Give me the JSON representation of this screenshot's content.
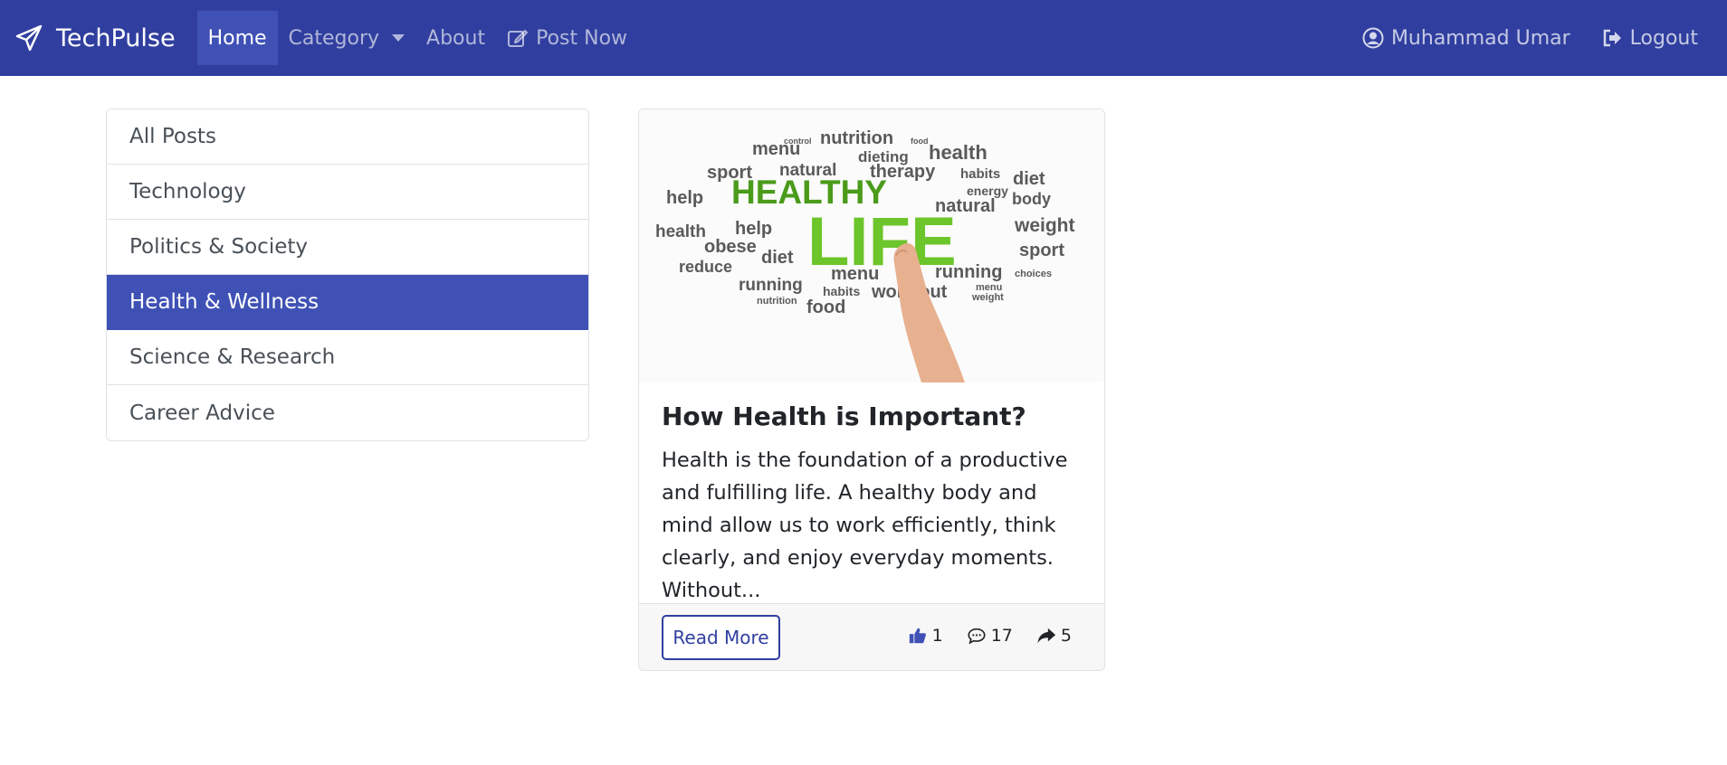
{
  "navbar": {
    "brand": "TechPulse",
    "links": [
      {
        "label": "Home",
        "icon": "none"
      },
      {
        "label": "Category",
        "icon": "caret-down"
      },
      {
        "label": "About",
        "icon": "none"
      },
      {
        "label": "Post Now",
        "icon": "edit-icon"
      }
    ],
    "user_name": "Muhammad Umar",
    "logout_label": "Logout",
    "colors": {
      "background": "#303f9f",
      "active": "#3f51b5"
    }
  },
  "sidebar": {
    "items": [
      {
        "label": "All Posts"
      },
      {
        "label": "Technology"
      },
      {
        "label": "Politics & Society"
      },
      {
        "label": "Health & Wellness",
        "active": true
      },
      {
        "label": "Science & Research"
      },
      {
        "label": "Career Advice"
      }
    ]
  },
  "post": {
    "title": "How Health is Important?",
    "excerpt": "Health is the foundation of a productive and fulfilling life. A healthy body and mind allow us to work efficiently, think clearly, and enjoy everyday moments. Without...",
    "read_more": "Read More",
    "likes": "1",
    "comments": "17",
    "shares": "5",
    "image_words": {
      "big1": "HEALTHY",
      "big2": "LIFE",
      "words": [
        "nutrition",
        "menu",
        "health",
        "dieting",
        "sport",
        "natural",
        "therapy",
        "habits",
        "diet",
        "help",
        "body",
        "energy",
        "natural",
        "weight",
        "health",
        "obese",
        "help",
        "diet",
        "sport",
        "reduce",
        "menu",
        "running",
        "running",
        "habits",
        "work out",
        "food",
        "nutrition",
        "weight",
        "menu",
        "choices",
        "control",
        "food"
      ]
    }
  }
}
